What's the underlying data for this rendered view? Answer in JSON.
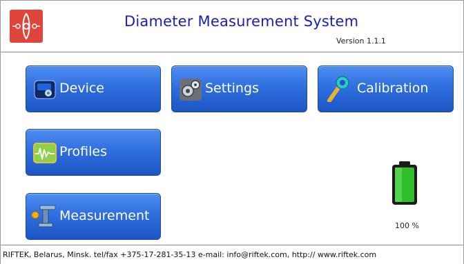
{
  "header": {
    "title": "Diameter Measurement System",
    "version": "Version 1.1.1",
    "logo_icon": "riftek-logo-icon"
  },
  "buttons": {
    "device": {
      "label": "Device",
      "icon": "device-icon"
    },
    "settings": {
      "label": "Settings",
      "icon": "gears-icon"
    },
    "calibration": {
      "label": "Calibration",
      "icon": "wrench-icon"
    },
    "profiles": {
      "label": "Profiles",
      "icon": "waveform-icon"
    },
    "measurement": {
      "label": "Measurement",
      "icon": "caliper-icon"
    }
  },
  "battery": {
    "percent_label": "100 %",
    "level": 1.0
  },
  "footer": {
    "text": "RIFTEK, Belarus, Minsk.  tel/fax +375-17-281-35-13  e-mail: info@riftek.com, http:// www.riftek.com"
  },
  "colors": {
    "title": "#1a1fb0",
    "button_blue": "#2f6fe0",
    "logo_red": "#e0453b",
    "battery_green": "#2fbf2a"
  }
}
